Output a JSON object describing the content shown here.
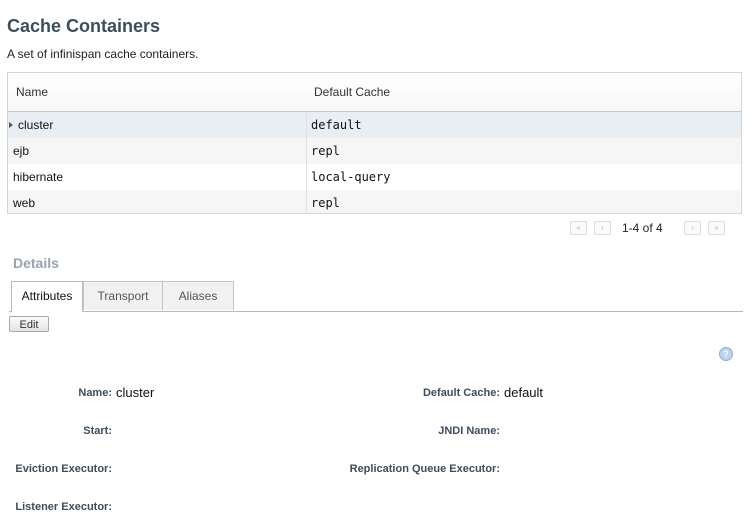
{
  "page": {
    "title": "Cache Containers",
    "description": "A set of infinispan cache containers."
  },
  "grid": {
    "columns": [
      "Name",
      "Default Cache"
    ],
    "rows": [
      {
        "name": "cluster",
        "default_cache": "default",
        "selected": true
      },
      {
        "name": "ejb",
        "default_cache": "repl"
      },
      {
        "name": "hibernate",
        "default_cache": "local-query"
      },
      {
        "name": "web",
        "default_cache": "repl"
      }
    ]
  },
  "pager": {
    "text": "1-4 of 4",
    "first_icon": "double-chevron-left-icon",
    "prev_icon": "chevron-left-icon",
    "next_icon": "chevron-right-icon",
    "last_icon": "double-chevron-right-icon"
  },
  "details": {
    "title": "Details",
    "tabs": [
      {
        "label": "Attributes",
        "active": true
      },
      {
        "label": "Transport"
      },
      {
        "label": "Aliases"
      }
    ],
    "edit_label": "Edit",
    "help_icon": "question-icon",
    "fields": {
      "name": {
        "label": "Name:",
        "value": "cluster"
      },
      "default_cache": {
        "label": "Default Cache:",
        "value": "default"
      },
      "start": {
        "label": "Start:",
        "value": ""
      },
      "jndi_name": {
        "label": "JNDI Name:",
        "value": ""
      },
      "eviction_executor": {
        "label": "Eviction Executor:",
        "value": ""
      },
      "replication_queue_executor": {
        "label": "Replication Queue Executor:",
        "value": ""
      },
      "listener_executor": {
        "label": "Listener Executor:",
        "value": ""
      }
    }
  }
}
